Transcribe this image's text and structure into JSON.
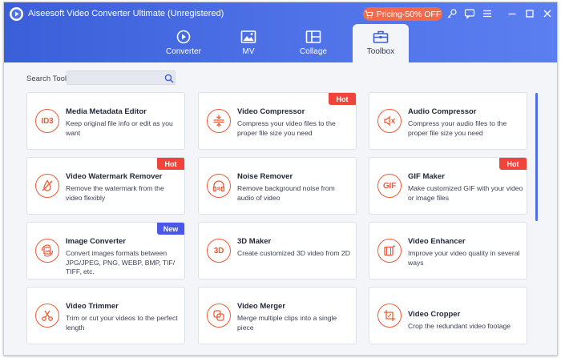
{
  "app": {
    "title": "Aiseesoft Video Converter Ultimate (Unregistered)",
    "pricing_label": "Pricing-50% OFF"
  },
  "colors": {
    "accent": "#4f72e8",
    "icon_orange": "#f05a36",
    "hot_badge": "#f0433a",
    "new_badge": "#4a58e8"
  },
  "nav": {
    "tabs": [
      {
        "label": "Converter",
        "icon": "converter-icon"
      },
      {
        "label": "MV",
        "icon": "mv-icon"
      },
      {
        "label": "Collage",
        "icon": "collage-icon"
      },
      {
        "label": "Toolbox",
        "icon": "toolbox-icon",
        "active": true
      }
    ]
  },
  "search": {
    "label": "Search Tool:",
    "value": "",
    "placeholder": ""
  },
  "tools": [
    {
      "title": "Media Metadata Editor",
      "desc": "Keep original file info or edit as you want",
      "icon": "id3-icon",
      "icon_text": "ID3",
      "badge": ""
    },
    {
      "title": "Video Compressor",
      "desc": "Compress your video files to the proper file size you need",
      "icon": "compress-icon",
      "badge": "Hot"
    },
    {
      "title": "Audio Compressor",
      "desc": "Compress your audio files to the proper file size you need",
      "icon": "audio-compress-icon",
      "badge": ""
    },
    {
      "title": "Video Watermark Remover",
      "desc": "Remove the watermark from the video flexibly",
      "icon": "watermark-icon",
      "badge": "Hot"
    },
    {
      "title": "Noise Remover",
      "desc": "Remove background noise from audio of video",
      "icon": "headphones-icon",
      "badge": ""
    },
    {
      "title": "GIF Maker",
      "desc": "Make customized GIF with your video or image files",
      "icon": "gif-icon",
      "icon_text": "GIF",
      "badge": "Hot"
    },
    {
      "title": "Image Converter",
      "desc": "Convert images formats between JPG/JPEG, PNG, WEBP, BMP, TIF/ TIFF, etc.",
      "icon": "image-convert-icon",
      "badge": "New"
    },
    {
      "title": "3D Maker",
      "desc": "Create customized 3D video from 2D",
      "icon": "3d-icon",
      "icon_text": "3D",
      "badge": ""
    },
    {
      "title": "Video Enhancer",
      "desc": "Improve your video quality in several ways",
      "icon": "enhance-icon",
      "badge": ""
    },
    {
      "title": "Video Trimmer",
      "desc": "Trim or cut your videos to the perfect length",
      "icon": "scissors-icon",
      "badge": ""
    },
    {
      "title": "Video Merger",
      "desc": "Merge multiple clips into a single piece",
      "icon": "merge-icon",
      "badge": ""
    },
    {
      "title": "Video Cropper",
      "desc": "Crop the redundant video footage",
      "icon": "crop-icon",
      "badge": ""
    }
  ]
}
